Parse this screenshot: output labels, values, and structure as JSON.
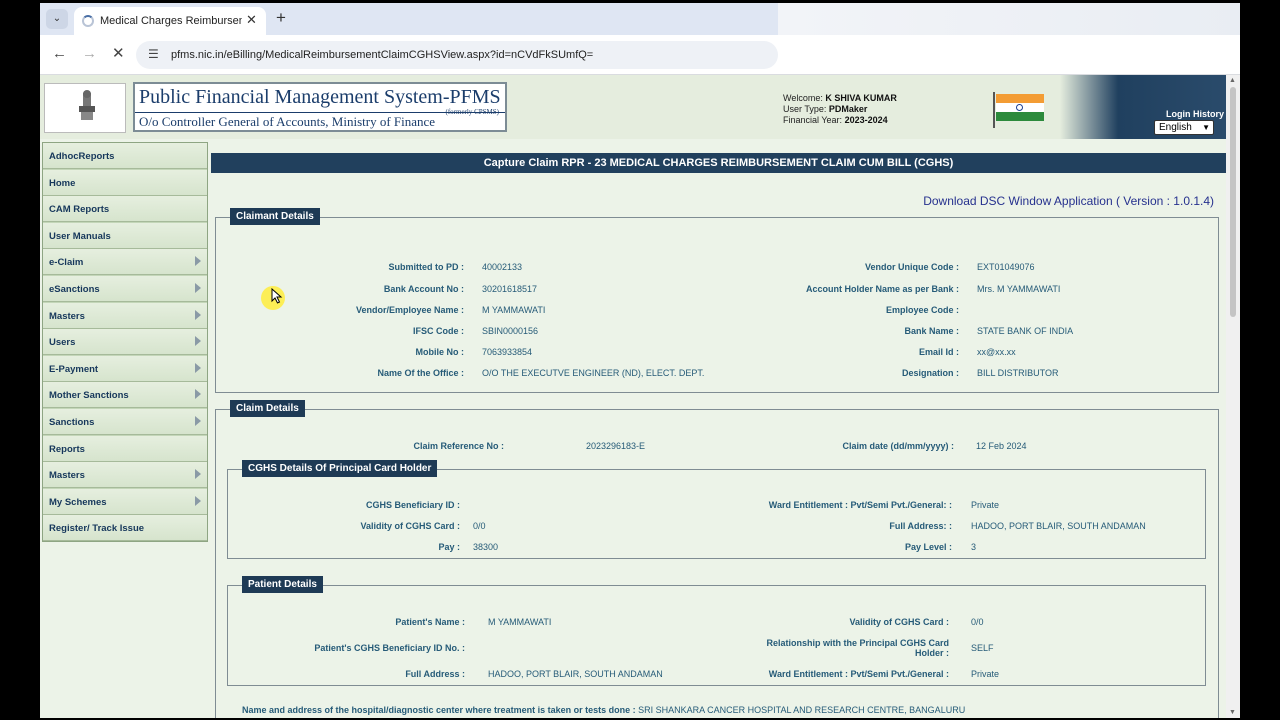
{
  "browser": {
    "tab_title": "Medical Charges Reimburseme",
    "url": "pfms.nic.in/eBilling/MedicalReimbursementClaimCGHSView.aspx?id=nCVdFkSUmfQ="
  },
  "header": {
    "title": "Public Financial Management System-PFMS",
    "formerly": "(formerly CPSMS)",
    "subtitle": "O/o Controller General of Accounts, Ministry of Finance",
    "welcome_label": "Welcome:",
    "welcome_name": "K SHIVA KUMAR",
    "user_type_label": "User Type:",
    "user_type": "PDMaker",
    "fy_label": "Financial Year:",
    "fy": "2023-2024",
    "login_history": "Login History",
    "language": "English"
  },
  "sidebar": {
    "items": [
      {
        "label": "AdhocReports",
        "has_sub": false
      },
      {
        "label": "Home",
        "has_sub": false
      },
      {
        "label": "CAM Reports",
        "has_sub": false
      },
      {
        "label": "User Manuals",
        "has_sub": false
      },
      {
        "label": "e-Claim",
        "has_sub": true
      },
      {
        "label": "eSanctions",
        "has_sub": true
      },
      {
        "label": "Masters",
        "has_sub": true
      },
      {
        "label": "Users",
        "has_sub": true
      },
      {
        "label": "E-Payment",
        "has_sub": true
      },
      {
        "label": "Mother Sanctions",
        "has_sub": true
      },
      {
        "label": "Sanctions",
        "has_sub": true
      },
      {
        "label": "Reports",
        "has_sub": false
      },
      {
        "label": "Masters",
        "has_sub": true
      },
      {
        "label": "My Schemes",
        "has_sub": true
      },
      {
        "label": "Register/ Track Issue",
        "has_sub": false
      }
    ]
  },
  "content": {
    "title": "Capture Claim RPR - 23 MEDICAL CHARGES REIMBURSEMENT CLAIM CUM BILL (CGHS)",
    "dsc_link": "Download DSC Window Application ( Version : 1.0.1.4)"
  },
  "claimant": {
    "legend": "Claimant Details",
    "submitted_to_pd_label": "Submitted to PD :",
    "submitted_to_pd": "40002133",
    "bank_account_label": "Bank Account No :",
    "bank_account": "30201618517",
    "vendor_name_label": "Vendor/Employee Name :",
    "vendor_name": "M YAMMAWATI",
    "ifsc_label": "IFSC Code :",
    "ifsc": "SBIN0000156",
    "mobile_label": "Mobile No :",
    "mobile": "7063933854",
    "office_label": "Name Of the Office :",
    "office": "O/O THE EXECUTVE ENGINEER (ND), ELECT. DEPT.",
    "vendor_code_label": "Vendor Unique Code :",
    "vendor_code": "EXT01049076",
    "holder_name_label": "Account Holder Name as per Bank :",
    "holder_name": "Mrs. M YAMMAWATI",
    "employee_code_label": "Employee Code :",
    "bank_name_label": "Bank Name :",
    "bank_name": "STATE BANK OF INDIA",
    "email_label": "Email Id :",
    "email": "xx@xx.xx",
    "designation_label": "Designation :",
    "designation": "BILL DISTRIBUTOR"
  },
  "claim": {
    "legend": "Claim Details",
    "ref_label": "Claim Reference No :",
    "ref": "2023296183-E",
    "date_label": "Claim date (dd/mm/yyyy) :",
    "date": "12 Feb 2024"
  },
  "cghs": {
    "legend": "CGHS Details Of Principal Card Holder",
    "beneficiary_label": "CGHS Beneficiary ID :",
    "validity_label": "Validity of CGHS Card :",
    "validity": "0/0",
    "pay_label": "Pay :",
    "pay": "38300",
    "ward_label": "Ward Entitlement : Pvt/Semi Pvt./General: :",
    "ward": "Private",
    "address_label": "Full Address: :",
    "address": "HADOO, PORT BLAIR, SOUTH ANDAMAN",
    "pay_level_label": "Pay Level :",
    "pay_level": "3"
  },
  "patient": {
    "legend": "Patient Details",
    "name_label": "Patient's Name :",
    "name": "M YAMMAWATI",
    "beneficiary_label": "Patient's CGHS Beneficiary ID No. :",
    "address_label": "Full Address :",
    "address": "HADOO, PORT BLAIR, SOUTH ANDAMAN",
    "validity_label": "Validity of CGHS Card :",
    "validity": "0/0",
    "relationship_label": "Relationship with the Principal CGHS Card Holder :",
    "relationship": "SELF",
    "ward_label": "Ward Entitlement : Pvt/Semi Pvt./General :",
    "ward": "Private"
  },
  "hospital": {
    "label": "Name and address of the hospital/diagnostic center where treatment is taken or tests done :",
    "value": "SRI SHANKARA CANCER HOSPITAL AND RESEARCH CENTRE, BANGALURU"
  }
}
